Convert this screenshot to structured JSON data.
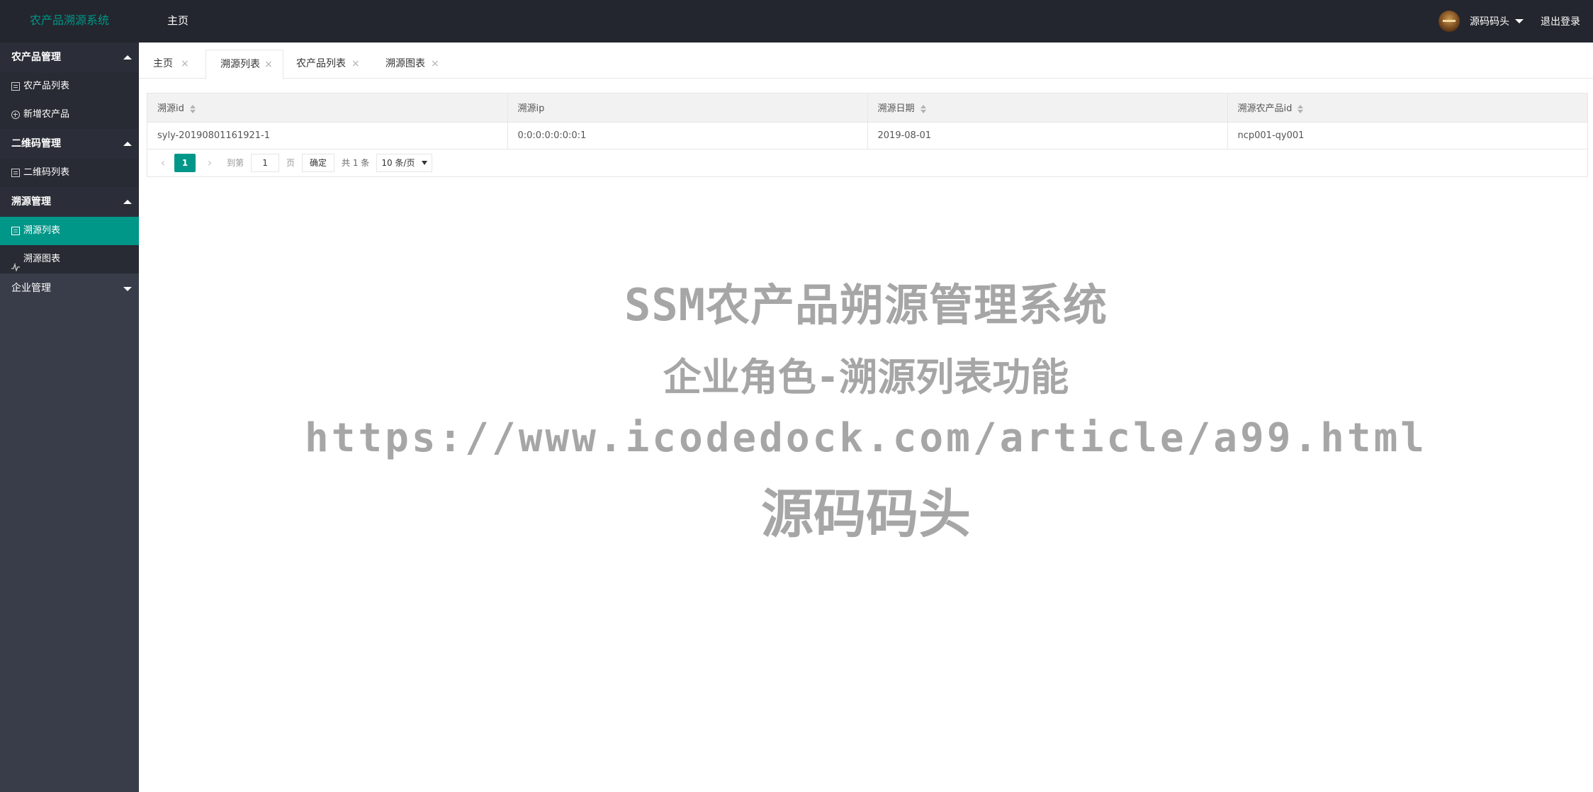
{
  "header": {
    "logo": "农产品溯源系统",
    "nav_home": "主页",
    "user_name": "源码码头",
    "logout": "退出登录"
  },
  "sidebar": {
    "groups": [
      {
        "title": "农产品管理",
        "expanded": true,
        "items": [
          {
            "label": "农产品列表",
            "icon": "list-icon"
          },
          {
            "label": "新增农产品",
            "icon": "add-circle-icon"
          }
        ]
      },
      {
        "title": "二维码管理",
        "expanded": true,
        "items": [
          {
            "label": "二维码列表",
            "icon": "list-icon"
          }
        ]
      },
      {
        "title": "溯源管理",
        "expanded": true,
        "items": [
          {
            "label": "溯源列表",
            "icon": "list-icon",
            "active": true
          },
          {
            "label": "溯源图表",
            "icon": "chart-icon"
          }
        ]
      },
      {
        "title": "企业管理",
        "expanded": false,
        "items": []
      }
    ]
  },
  "tabs": [
    {
      "label": "主页",
      "active": false
    },
    {
      "label": "溯源列表",
      "active": true
    },
    {
      "label": "农产品列表",
      "active": false
    },
    {
      "label": "溯源图表",
      "active": false
    }
  ],
  "close_glyph": "×",
  "table": {
    "columns": [
      "溯源id",
      "溯源ip",
      "溯源日期",
      "溯源农产品id"
    ],
    "rows": [
      [
        "syly-20190801161921-1",
        "0:0:0:0:0:0:0:1",
        "2019-08-01",
        "ncp001-qy001"
      ]
    ]
  },
  "pagination": {
    "current_page": "1",
    "skip_label": "到第",
    "page_input": "1",
    "page_unit": "页",
    "confirm": "确定",
    "total": "共 1 条",
    "page_size": "10 条/页"
  },
  "watermark": {
    "line1": "SSM农产品朔源管理系统",
    "line2": "企业角色-溯源列表功能",
    "line3": "https://www.icodedock.com/article/a99.html",
    "line4": "源码码头"
  },
  "colors": {
    "accent": "#009688",
    "header_bg": "#23262e",
    "sidebar_bg": "#393d49"
  }
}
